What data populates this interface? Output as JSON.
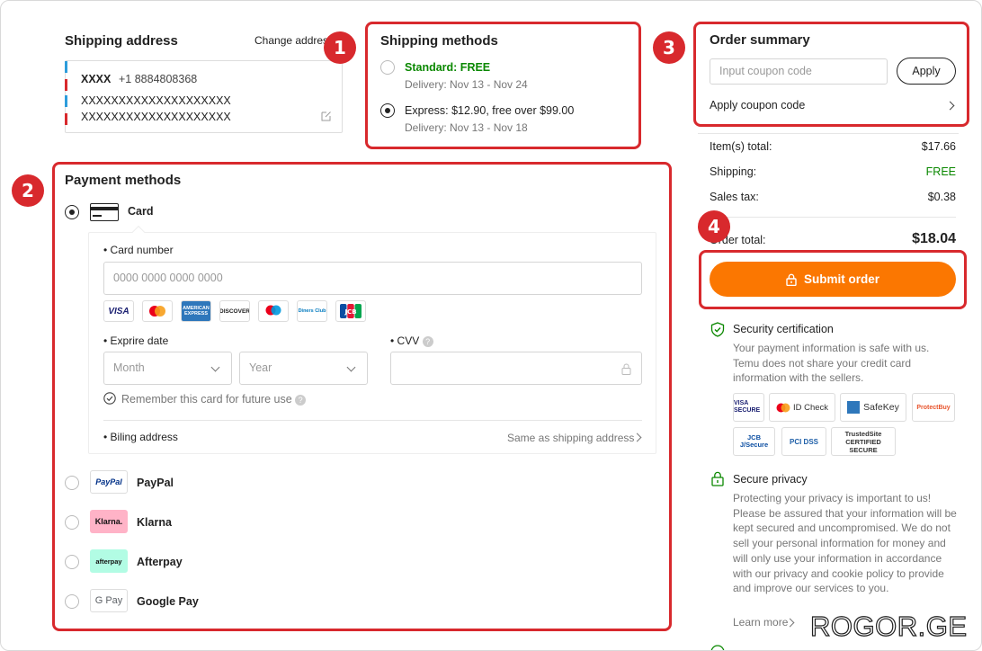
{
  "shipping_address": {
    "title": "Shipping address",
    "change_link": "Change address",
    "name": "XXXX",
    "phone": "+1 8884808368",
    "line1": "XXXXXXXXXXXXXXXXXXXX",
    "line2": "XXXXXXXXXXXXXXXXXXXX"
  },
  "shipping_methods": {
    "title": "Shipping methods",
    "options": [
      {
        "label": "Standard: FREE",
        "delivery": "Delivery: Nov 13 - Nov 24",
        "selected": false
      },
      {
        "label": "Express: $12.90, free over $99.00",
        "delivery": "Delivery: Nov 13 - Nov 18",
        "selected": true
      }
    ]
  },
  "payment_methods": {
    "title": "Payment methods",
    "card": {
      "label": "Card",
      "card_number_label": "Card number",
      "card_number_placeholder": "0000 0000 0000 0000",
      "logos": [
        "VISA",
        "mastercard",
        "AMERICAN EXPRESS",
        "DISCOVER",
        "maestro",
        "Diners Club",
        "JCB"
      ],
      "expire_label": "Exprire date",
      "month_placeholder": "Month",
      "year_placeholder": "Year",
      "cvv_label": "CVV",
      "remember_label": "Remember this card for future use",
      "billing_label": "Biling address",
      "billing_value": "Same as shipping address"
    },
    "others": [
      {
        "label": "PayPal",
        "logo": "PayPal"
      },
      {
        "label": "Klarna",
        "logo": "Klarna."
      },
      {
        "label": "Afterpay",
        "logo": "afterpay"
      },
      {
        "label": "Google Pay",
        "logo": "G Pay"
      }
    ]
  },
  "order_summary": {
    "title": "Order summary",
    "coupon_placeholder": "Input coupon code",
    "apply_button": "Apply",
    "apply_coupon_link": "Apply coupon code",
    "rows": [
      {
        "label": "Item(s) total:",
        "value": "$17.66"
      },
      {
        "label": "Shipping:",
        "value": "FREE"
      },
      {
        "label": "Sales tax:",
        "value": "$0.38"
      }
    ],
    "total_label": "Order total:",
    "total_value": "$18.04",
    "submit_button": "Submit order"
  },
  "security": {
    "title": "Security certification",
    "text": "Your payment information is safe with us. Temu does not share your credit card information with the sellers.",
    "badges": [
      "VISA SECURE",
      "ID Check",
      "SafeKey",
      "ProtectBuy",
      "JCB J/Secure",
      "PCI DSS",
      "TrustedSite CERTIFIED SECURE"
    ]
  },
  "privacy": {
    "title": "Secure privacy",
    "text": "Protecting your privacy is important to us! Please be assured that your information will be kept secured and uncompromised. We do not sell your personal information for money and will only use your information in accordance with our privacy and cookie policy to provide and improve our services to you.",
    "learn_more": "Learn more"
  },
  "annotations": [
    "1",
    "2",
    "3",
    "4"
  ],
  "watermark": "ROGOR.GE",
  "colors": {
    "accent": "#fb7701",
    "annotation": "#d8292d",
    "green": "#0a8800"
  }
}
